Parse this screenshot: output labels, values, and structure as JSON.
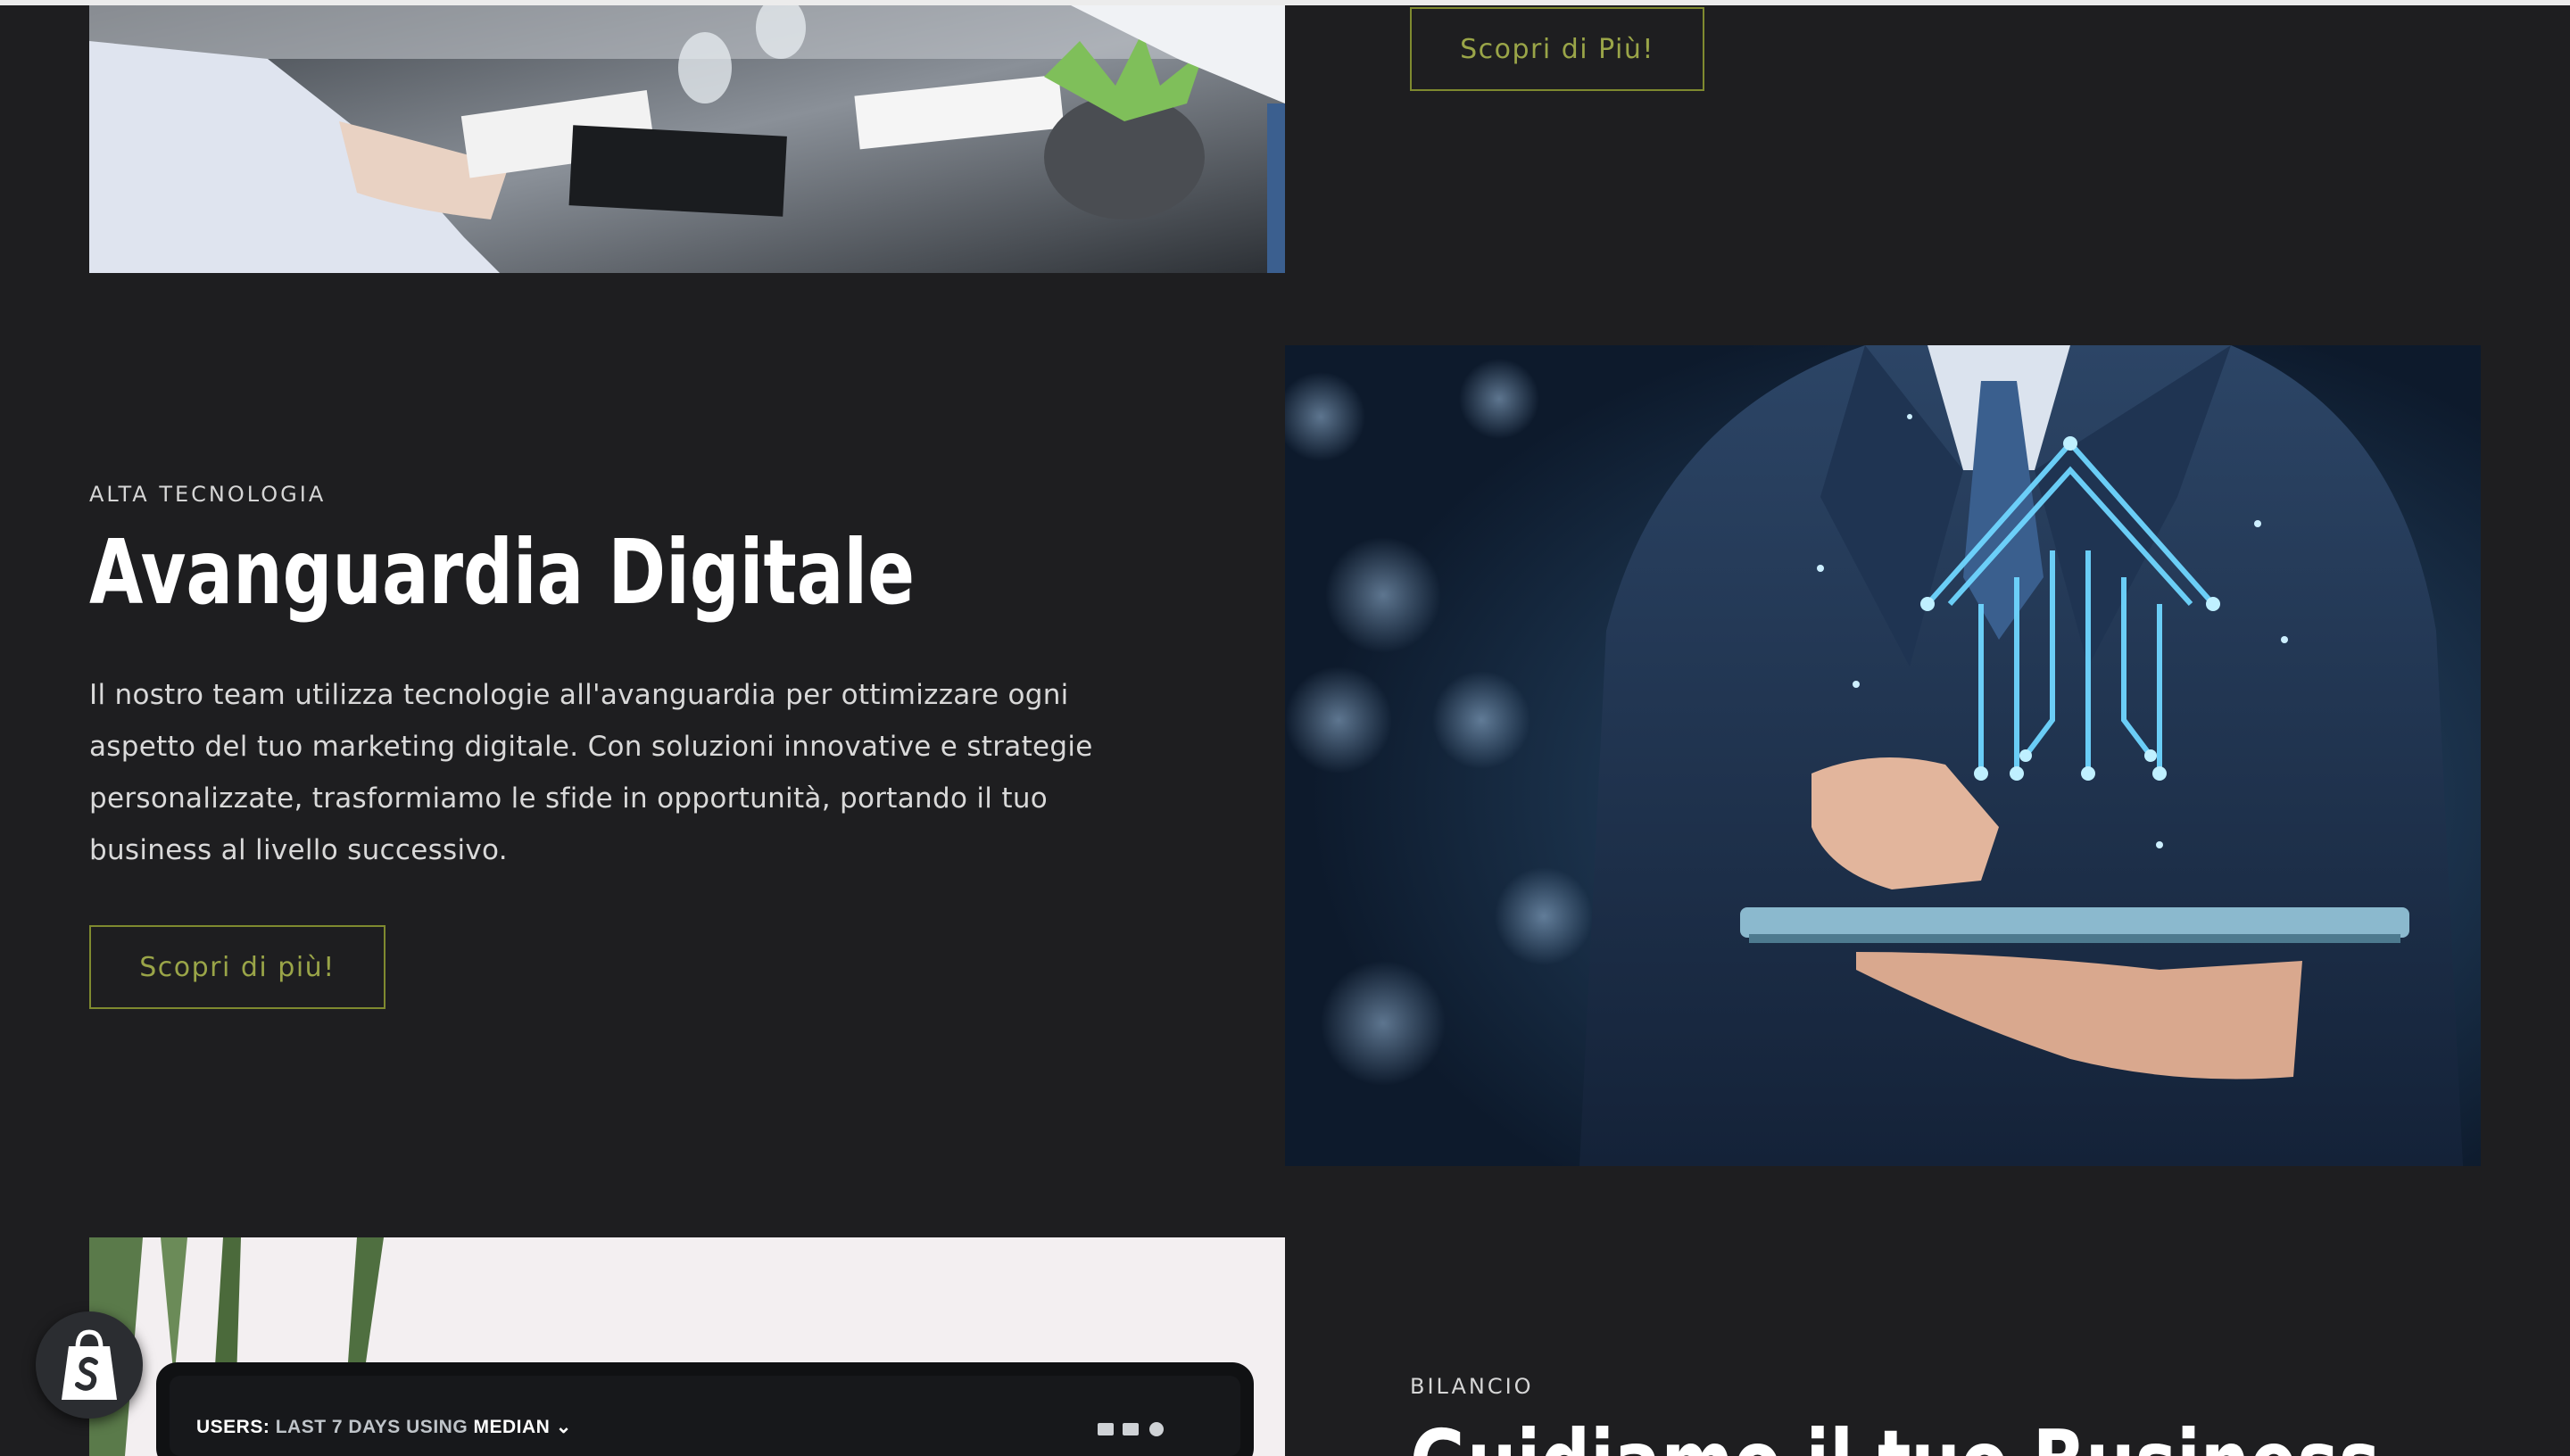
{
  "section_top": {
    "button_label": "Scopri di Più!"
  },
  "section_tech": {
    "eyebrow": "ALTA TECNOLOGIA",
    "heading": "Avanguardia Digitale",
    "body": "Il nostro team utilizza tecnologie all'avanguardia per ottimizzare ogni aspetto del tuo marketing digitale. Con soluzioni innovative e strategie personalizzate, trasformiamo le sfide in opportunità, portando il tuo business al livello successivo.",
    "button_label": "Scopri di più!"
  },
  "section_bilancio": {
    "eyebrow": "BILANCIO",
    "heading": "Guidiamo il tuo Business"
  },
  "laptop_screen": {
    "label_prefix": "USERS:",
    "label_range": "LAST 7 DAYS",
    "label_using": "USING",
    "label_metric": "MEDIAN"
  },
  "icons": {
    "shopify_badge": "shopify-bag-icon"
  },
  "colors": {
    "background": "#1e1e20",
    "accent_olive": "#9aa548",
    "heading": "#ffffff",
    "body": "#d9d9d9"
  }
}
